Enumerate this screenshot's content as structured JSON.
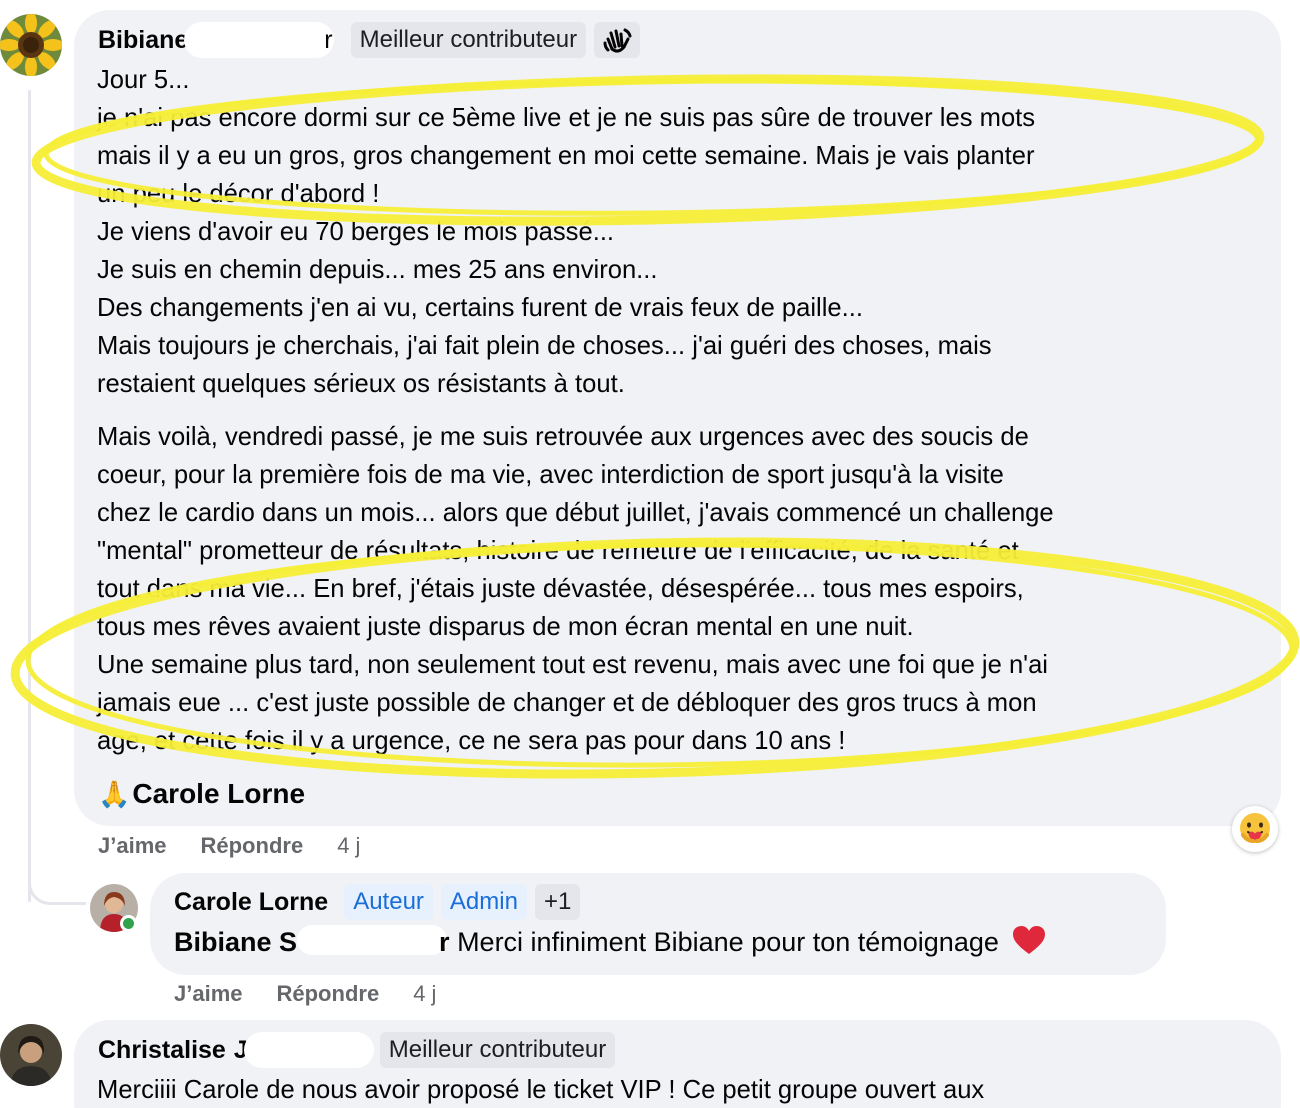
{
  "comments": [
    {
      "author": "Bibiane",
      "author_suffix": "r",
      "badge": "Meilleur contributeur",
      "badge_icon": "waving-hand-icon",
      "paragraphs": [
        [
          "Jour 5...",
          "je n'ai pas encore dormi sur ce 5ème live et je ne suis pas sûre de trouver les mots",
          "mais il y a eu un gros, gros changement en moi cette semaine. Mais je vais planter",
          "un peu le décor d'abord !",
          "Je viens d'avoir eu 70 berges le mois passé...",
          "Je suis en chemin depuis... mes 25 ans environ...",
          "Des changements j'en ai vu, certains furent de vrais feux de paille...",
          "Mais toujours je cherchais, j'ai fait plein de choses... j'ai guéri des choses, mais",
          "restaient quelques sérieux os résistants à tout."
        ],
        [
          "Mais voilà, vendredi passé, je me suis retrouvée aux urgences avec des soucis de",
          "coeur, pour la première fois de ma vie, avec interdiction de sport jusqu'à la visite",
          "chez le cardio dans un mois... alors que début juillet, j'avais commencé un challenge",
          "\"mental\" prometteur de résultats, histoire de remettre de l'efficacité, de la santé et",
          "tout dans ma vie... En bref, j'étais juste dévastée, désespérée... tous mes espoirs,",
          "tous mes rêves avaient juste disparus de mon écran mental en une nuit.",
          "Une semaine plus tard, non seulement tout est revenu, mais avec une foi que je n'ai",
          "jamais eue ... c'est juste possible de changer et de débloquer des gros trucs à mon",
          "age, et cette fois il y a urgence, ce ne sera pas pour dans 10 ans !"
        ]
      ],
      "signoff_emoji": "🙏",
      "signoff_name": "Carole Lorne",
      "like": "J’aime",
      "reply": "Répondre",
      "time": "4 j",
      "reaction_icon": "care-reaction-icon"
    },
    {
      "author": "Carole Lorne",
      "badges": [
        "Auteur",
        "Admin",
        "+1"
      ],
      "mention": "Bibiane S",
      "mention_suffix": "r",
      "text": "Merci infiniment Bibiane pour ton témoignage",
      "like": "J’aime",
      "reply": "Répondre",
      "time": "4 j"
    },
    {
      "author": "Christalise",
      "author_suffix": "J",
      "badge": "Meilleur contributeur",
      "text": "Merciiii Carole de nous avoir proposé le ticket VIP ! Ce petit groupe ouvert aux"
    }
  ],
  "colors": {
    "bubble": "#f0f2f5",
    "badge": "#e4e6eb",
    "badge_blue_text": "#1a6ed8",
    "meta_text": "#65676b",
    "highlight": "#f5ee38",
    "online": "#31a24c"
  }
}
